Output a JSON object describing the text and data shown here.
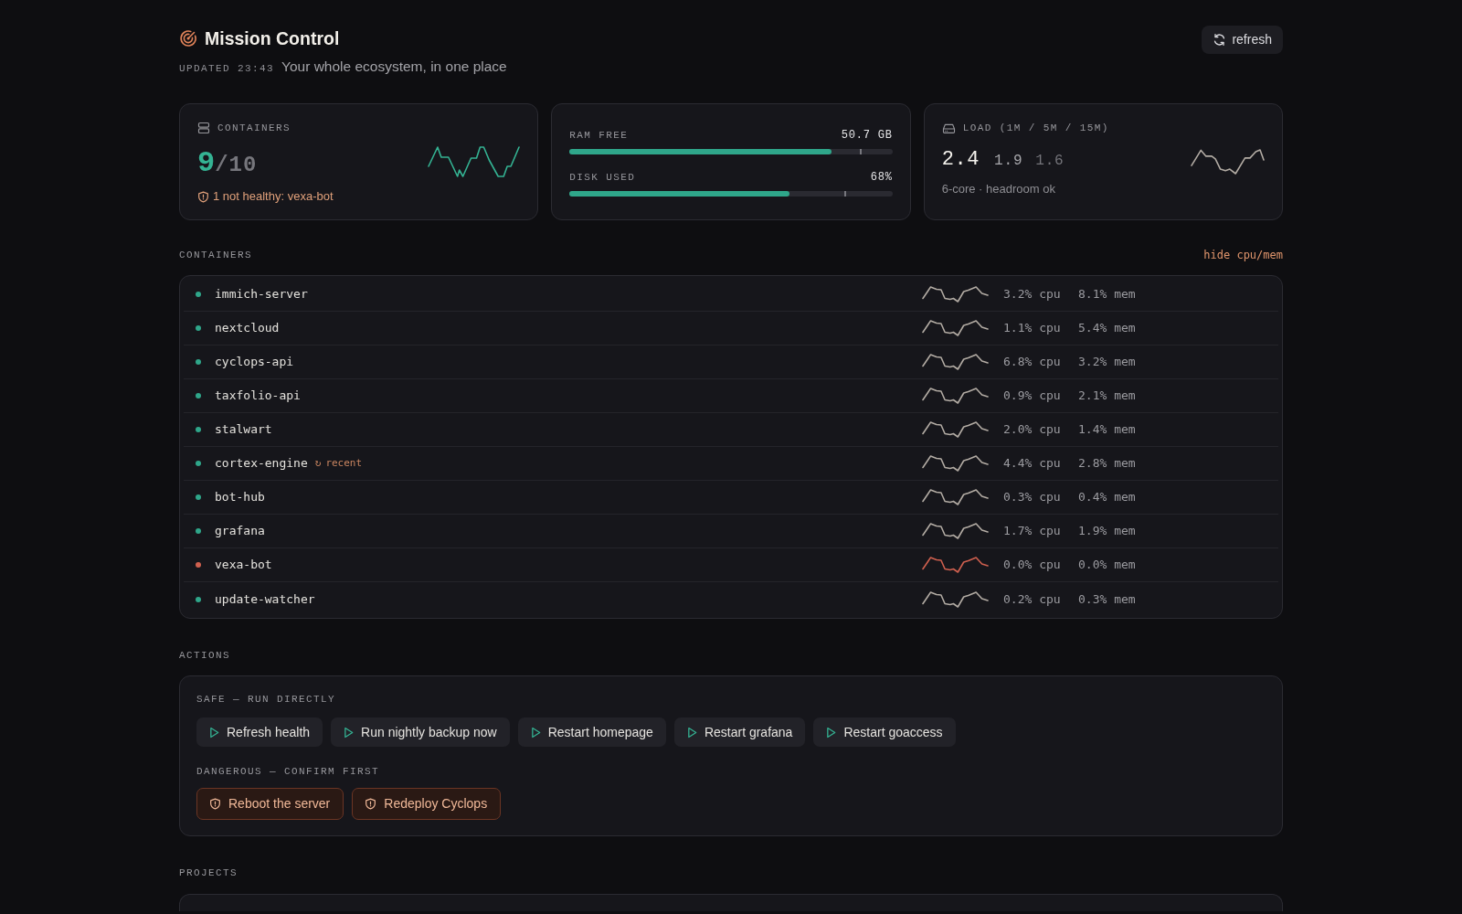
{
  "header": {
    "title": "Mission Control",
    "updated": "UPDATED 23:43",
    "subtitle": "Your whole ecosystem, in one place",
    "refresh_button": "refresh"
  },
  "summary": {
    "containers": {
      "label": "CONTAINERS",
      "running": "9",
      "total": "/10",
      "alert": "1 not healthy: vexa-bot"
    },
    "resources": [
      {
        "label": "RAM FREE",
        "reading": "50.7 GB",
        "level": 0.81,
        "marker": {
          "level": 0.9
        }
      },
      {
        "label": "DISK USED",
        "reading": "68%",
        "level": 0.68,
        "marker": {
          "level": 0.85
        }
      }
    ],
    "load": {
      "label": "LOAD (1M / 5M / 15M)",
      "values": [
        "2.4",
        "1.9",
        "1.6"
      ],
      "note": "6-core · headroom ok"
    }
  },
  "containers": {
    "heading": "CONTAINERS",
    "toggle": "hide cpu/mem",
    "rows": [
      {
        "name": "immich-server",
        "healthy": true,
        "cpu": "3.2% cpu",
        "mem": "8.1% mem"
      },
      {
        "name": "nextcloud",
        "healthy": true,
        "cpu": "1.1% cpu",
        "mem": "5.4% mem"
      },
      {
        "name": "cyclops-api",
        "healthy": true,
        "cpu": "6.8% cpu",
        "mem": "3.2% mem"
      },
      {
        "name": "taxfolio-api",
        "healthy": true,
        "cpu": "0.9% cpu",
        "mem": "2.1% mem"
      },
      {
        "name": "stalwart",
        "healthy": true,
        "cpu": "2.0% cpu",
        "mem": "1.4% mem"
      },
      {
        "name": "cortex-engine",
        "healthy": true,
        "tag": {
          "icon": "↻",
          "label": "recent"
        },
        "cpu": "4.4% cpu",
        "mem": "2.8% mem"
      },
      {
        "name": "bot-hub",
        "healthy": true,
        "cpu": "0.3% cpu",
        "mem": "0.4% mem"
      },
      {
        "name": "grafana",
        "healthy": true,
        "cpu": "1.7% cpu",
        "mem": "1.9% mem"
      },
      {
        "name": "vexa-bot",
        "healthy": false,
        "cpu": "0.0% cpu",
        "mem": "0.0% mem"
      },
      {
        "name": "update-watcher",
        "healthy": true,
        "cpu": "0.2% cpu",
        "mem": "0.3% mem"
      }
    ]
  },
  "actions": {
    "heading": "ACTIONS",
    "groups": [
      {
        "kind": "safe",
        "label": "SAFE — RUN DIRECTLY",
        "buttons": [
          "Refresh health",
          "Run nightly backup now",
          "Restart homepage",
          "Restart grafana",
          "Restart goaccess"
        ]
      },
      {
        "kind": "dangerous",
        "label": "DANGEROUS — CONFIRM FIRST",
        "buttons": [
          "Reboot the server",
          "Redeploy Cyclops"
        ]
      }
    ]
  },
  "projects": {
    "heading": "PROJECTS"
  }
}
